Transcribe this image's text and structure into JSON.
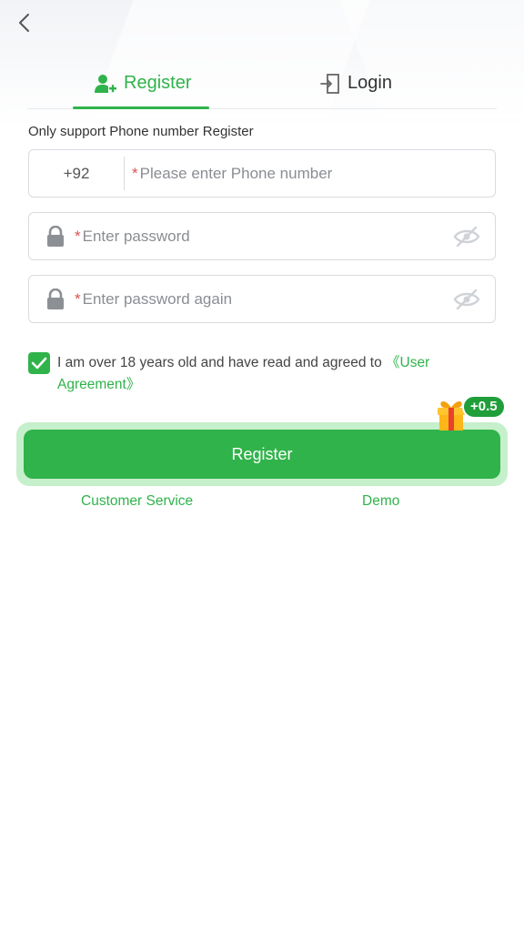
{
  "nav": {
    "back_icon": "chevron-left-icon"
  },
  "tabs": [
    {
      "label": "Register",
      "icon": "user-add-icon",
      "active": true
    },
    {
      "label": "Login",
      "icon": "login-door-icon",
      "active": false
    }
  ],
  "hint": "Only support Phone number Register",
  "phone": {
    "country_code": "+92",
    "required_mark": "*",
    "placeholder": "Please enter Phone number",
    "value": ""
  },
  "password": {
    "required_mark": "*",
    "placeholder": "Enter password",
    "value": ""
  },
  "password_confirm": {
    "required_mark": "*",
    "placeholder": "Enter password again",
    "value": ""
  },
  "agreement": {
    "checked": true,
    "text": "I am over 18 years old and have read and agreed to ",
    "link": "《User Agreement》"
  },
  "register_button": {
    "label": "Register",
    "bonus": "+0.5",
    "gift_icon": "gift-icon"
  },
  "footer": {
    "customer_service": "Customer Service",
    "demo": "Demo"
  },
  "colors": {
    "accent": "#2fb34a",
    "accent_light": "#c6efcc",
    "required": "#d9534f",
    "border": "#d8dbe0"
  }
}
